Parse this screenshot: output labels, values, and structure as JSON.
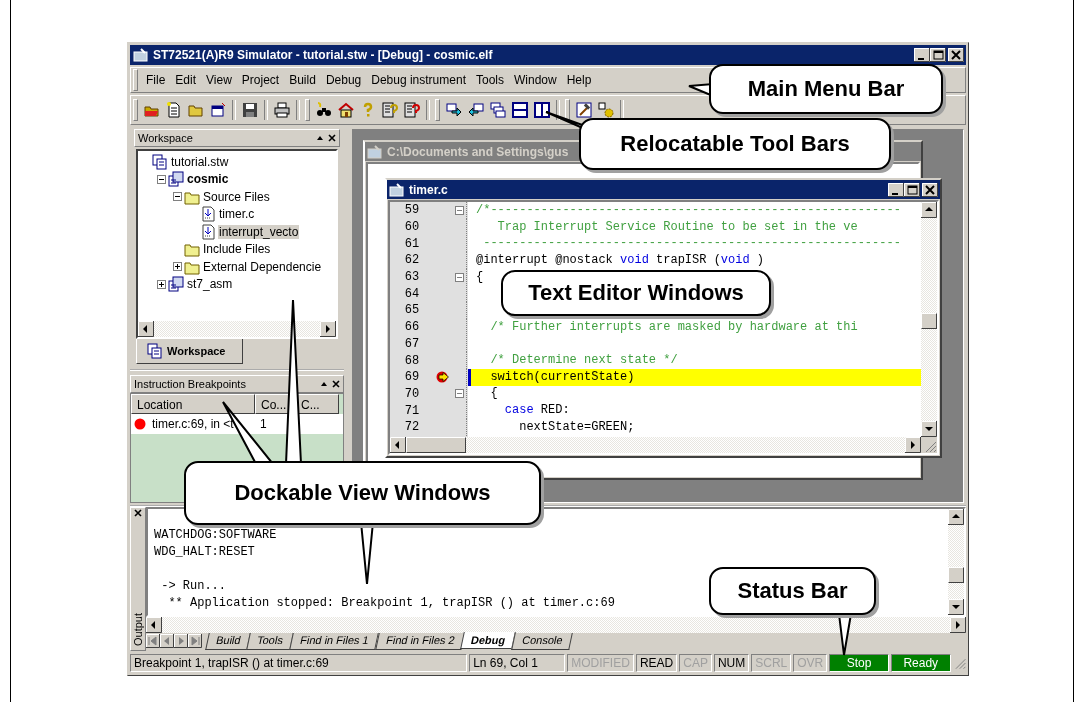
{
  "window": {
    "title": "ST72521(A)R9 Simulator - tutorial.stw - [Debug] - cosmic.elf"
  },
  "menu": [
    "File",
    "Edit",
    "View",
    "Project",
    "Build",
    "Debug",
    "Debug instrument",
    "Tools",
    "Window",
    "Help"
  ],
  "workspace": {
    "title": "Workspace",
    "tab": "Workspace",
    "tree": [
      {
        "label": "tutorial.stw",
        "kind": "workspace",
        "selected": false,
        "active": false,
        "children": [
          {
            "label": "cosmic",
            "kind": "project",
            "selected": false,
            "active": true,
            "expanded": true,
            "children": [
              {
                "label": "Source Files",
                "kind": "folder",
                "selected": false,
                "active": false,
                "expanded": true,
                "children": [
                  {
                    "label": "timer.c",
                    "kind": "file",
                    "selected": false,
                    "active": false
                  },
                  {
                    "label": "interrupt_vecto",
                    "kind": "file",
                    "selected": true,
                    "active": false
                  }
                ]
              },
              {
                "label": "Include Files",
                "kind": "folder",
                "selected": false,
                "active": false
              },
              {
                "label": "External Dependencie",
                "kind": "folder",
                "selected": false,
                "active": false,
                "expanded": false
              }
            ]
          },
          {
            "label": "st7_asm",
            "kind": "project",
            "selected": false,
            "active": false,
            "expanded": false
          }
        ]
      }
    ]
  },
  "breakpoints": {
    "title": "Instruction Breakpoints",
    "columns": [
      "Location",
      "Co...",
      "C..."
    ],
    "rows": [
      {
        "enabled": true,
        "cells": [
          "timer.c:69, in <t",
          "1"
        ]
      }
    ]
  },
  "background_window": {
    "title": "C:\\Documents and Settings\\gus"
  },
  "editor": {
    "title": "timer.c",
    "lines": [
      {
        "number": "59",
        "fold": true,
        "current": false,
        "tokens": [
          {
            "kind": "comment",
            "text": "/*---------------------------------------------------------"
          }
        ]
      },
      {
        "number": "60",
        "fold": false,
        "current": false,
        "tokens": [
          {
            "kind": "comment",
            "text": "   Trap Interrupt Service Routine to be set in the ve"
          }
        ]
      },
      {
        "number": "61",
        "fold": false,
        "current": false,
        "tokens": [
          {
            "kind": "comment",
            "text": " ----------------------------------------------------------"
          }
        ]
      },
      {
        "number": "62",
        "fold": false,
        "current": false,
        "tokens": [
          {
            "kind": "plain",
            "text": "@interrupt @nostack "
          },
          {
            "kind": "keyword",
            "text": "void"
          },
          {
            "kind": "plain",
            "text": " trapISR ("
          },
          {
            "kind": "keyword",
            "text": "void"
          },
          {
            "kind": "plain",
            "text": " )"
          }
        ]
      },
      {
        "number": "63",
        "fold": true,
        "current": false,
        "tokens": [
          {
            "kind": "plain",
            "text": "{"
          }
        ]
      },
      {
        "number": "64",
        "fold": false,
        "current": false
      },
      {
        "number": "65",
        "fold": false,
        "current": false
      },
      {
        "number": "66",
        "fold": false,
        "current": false,
        "tokens": [
          {
            "kind": "comment",
            "text": "  /* Further interrupts are masked by hardware at thi"
          }
        ]
      },
      {
        "number": "67",
        "fold": false,
        "current": false
      },
      {
        "number": "68",
        "fold": false,
        "current": false,
        "tokens": [
          {
            "kind": "comment",
            "text": "  /* Determine next state */"
          }
        ]
      },
      {
        "number": "69",
        "fold": false,
        "current": true,
        "tokens": [
          {
            "kind": "plain",
            "text": "  switch(currentState)"
          }
        ]
      },
      {
        "number": "70",
        "fold": true,
        "current": false,
        "tokens": [
          {
            "kind": "plain",
            "text": "  {"
          }
        ]
      },
      {
        "number": "71",
        "fold": false,
        "current": false,
        "tokens": [
          {
            "kind": "keyword",
            "text": "    case"
          },
          {
            "kind": "plain",
            "text": " RED:"
          }
        ]
      },
      {
        "number": "72",
        "fold": false,
        "current": false,
        "tokens": [
          {
            "kind": "plain",
            "text": "      nextState=GREEN;"
          }
        ]
      }
    ]
  },
  "output": {
    "side_label": "Output",
    "lines": [
      {
        "text": "WATCHDOG:SOFTWARE",
        "blank_before": false
      },
      {
        "text": "WDG_HALT:RESET",
        "blank_before": false
      },
      {
        "text": " -> Run...",
        "blank_before": true
      },
      {
        "text": "  ** Application stopped: Breakpoint 1, trapISR () at timer.c:69",
        "blank_before": false
      }
    ],
    "tabs": [
      {
        "label": "Build",
        "selected": false
      },
      {
        "label": "Tools",
        "selected": false
      },
      {
        "label": "Find in Files 1",
        "selected": false
      },
      {
        "label": "Find in Files 2",
        "selected": false
      },
      {
        "label": "Debug",
        "selected": true
      },
      {
        "label": "Console",
        "selected": false
      }
    ]
  },
  "status_bar": {
    "message": "Breakpoint 1, trapISR () at timer.c:69",
    "position": "Ln 69, Col 1",
    "indicators": [
      {
        "label": "MODIFIED",
        "kind": "flag",
        "on": false
      },
      {
        "label": "READ",
        "kind": "flag",
        "on": true
      },
      {
        "label": "CAP",
        "kind": "flag",
        "on": false
      },
      {
        "label": "NUM",
        "kind": "flag",
        "on": true
      },
      {
        "label": "SCRL",
        "kind": "flag",
        "on": false
      },
      {
        "label": "OVR",
        "kind": "flag",
        "on": false
      },
      {
        "label": "Stop",
        "kind": "state",
        "on": true
      },
      {
        "label": "Ready",
        "kind": "state",
        "on": true
      }
    ]
  },
  "callouts": [
    {
      "text": "Main Menu Bar"
    },
    {
      "text": "Relocatable Tool Bars"
    },
    {
      "text": "Text Editor Windows"
    },
    {
      "text": "Dockable View Windows"
    },
    {
      "text": "Status Bar"
    }
  ]
}
